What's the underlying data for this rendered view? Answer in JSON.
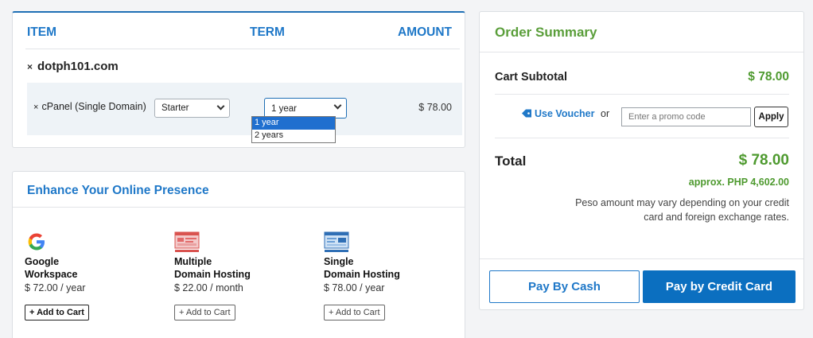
{
  "cart": {
    "headers": {
      "item": "ITEM",
      "term": "TERM",
      "amount": "AMOUNT"
    },
    "domain": "dotph101.com",
    "remove_glyph": "×",
    "addon": {
      "label": "cPanel (Single Domain)",
      "plan_value": "Starter",
      "term_value": "1 year",
      "amount": "$ 78.00"
    },
    "term_options": [
      "1 year",
      "2 years"
    ],
    "term_selected_index": 0
  },
  "enhance": {
    "title": "Enhance Your Online Presence",
    "products": [
      {
        "name_line1": "Google",
        "name_line2": "Workspace",
        "price": "$ 72.00 / year",
        "button": "+ Add to Cart",
        "icon": "google-icon"
      },
      {
        "name_line1": "Multiple",
        "name_line2": "Domain Hosting",
        "price": "$ 22.00 / month",
        "button": "+ Add to Cart",
        "icon": "multiple-hosting-icon"
      },
      {
        "name_line1": "Single",
        "name_line2": "Domain Hosting",
        "price": "$ 78.00 / year",
        "button": "+ Add to Cart",
        "icon": "single-hosting-icon"
      }
    ]
  },
  "summary": {
    "title": "Order Summary",
    "subtotal_label": "Cart Subtotal",
    "subtotal_value": "$ 78.00",
    "voucher_label": "Use Voucher",
    "or_text": "or",
    "promo_placeholder": "Enter a promo code",
    "apply_label": "Apply",
    "total_label": "Total",
    "total_value": "$ 78.00",
    "approx": "approx. PHP 4,602.00",
    "note": "Peso amount may vary depending on your credit card and foreign exchange rates.",
    "pay_cash_label": "Pay By Cash",
    "pay_card_label": "Pay by Credit Card"
  },
  "colors": {
    "accent_blue": "#1f78c8",
    "accent_green": "#4e9a2f",
    "primary_button": "#0b6fc0"
  }
}
